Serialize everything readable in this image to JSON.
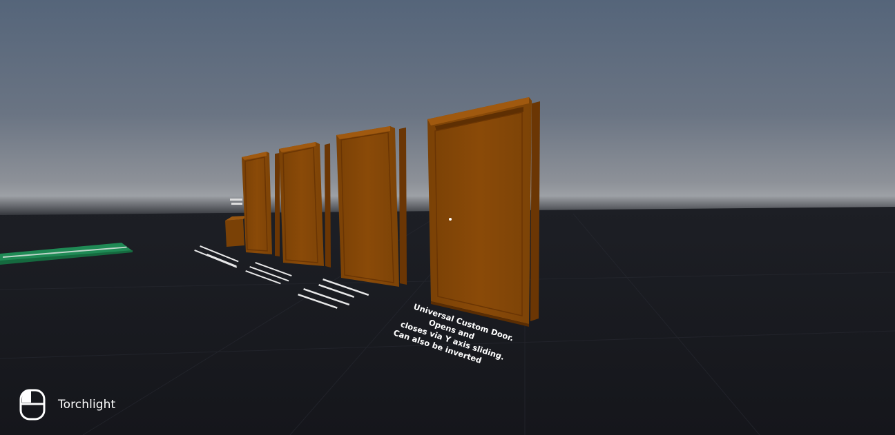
{
  "hud": {
    "input_icon": "mouse-icon",
    "label": "Torchlight"
  },
  "signs": {
    "sign_1": [
      "Universal Custom Door.",
      "Opens and",
      "closes via Y axis sliding.",
      "Can also be inverted"
    ]
  },
  "colors": {
    "sky_top": "#55657a",
    "sky_horizon": "#a7abb0",
    "floor": "#17181d",
    "door_wood": "#8a4a08",
    "door_frame": "#6b3604",
    "platform": "#1f8a55"
  }
}
